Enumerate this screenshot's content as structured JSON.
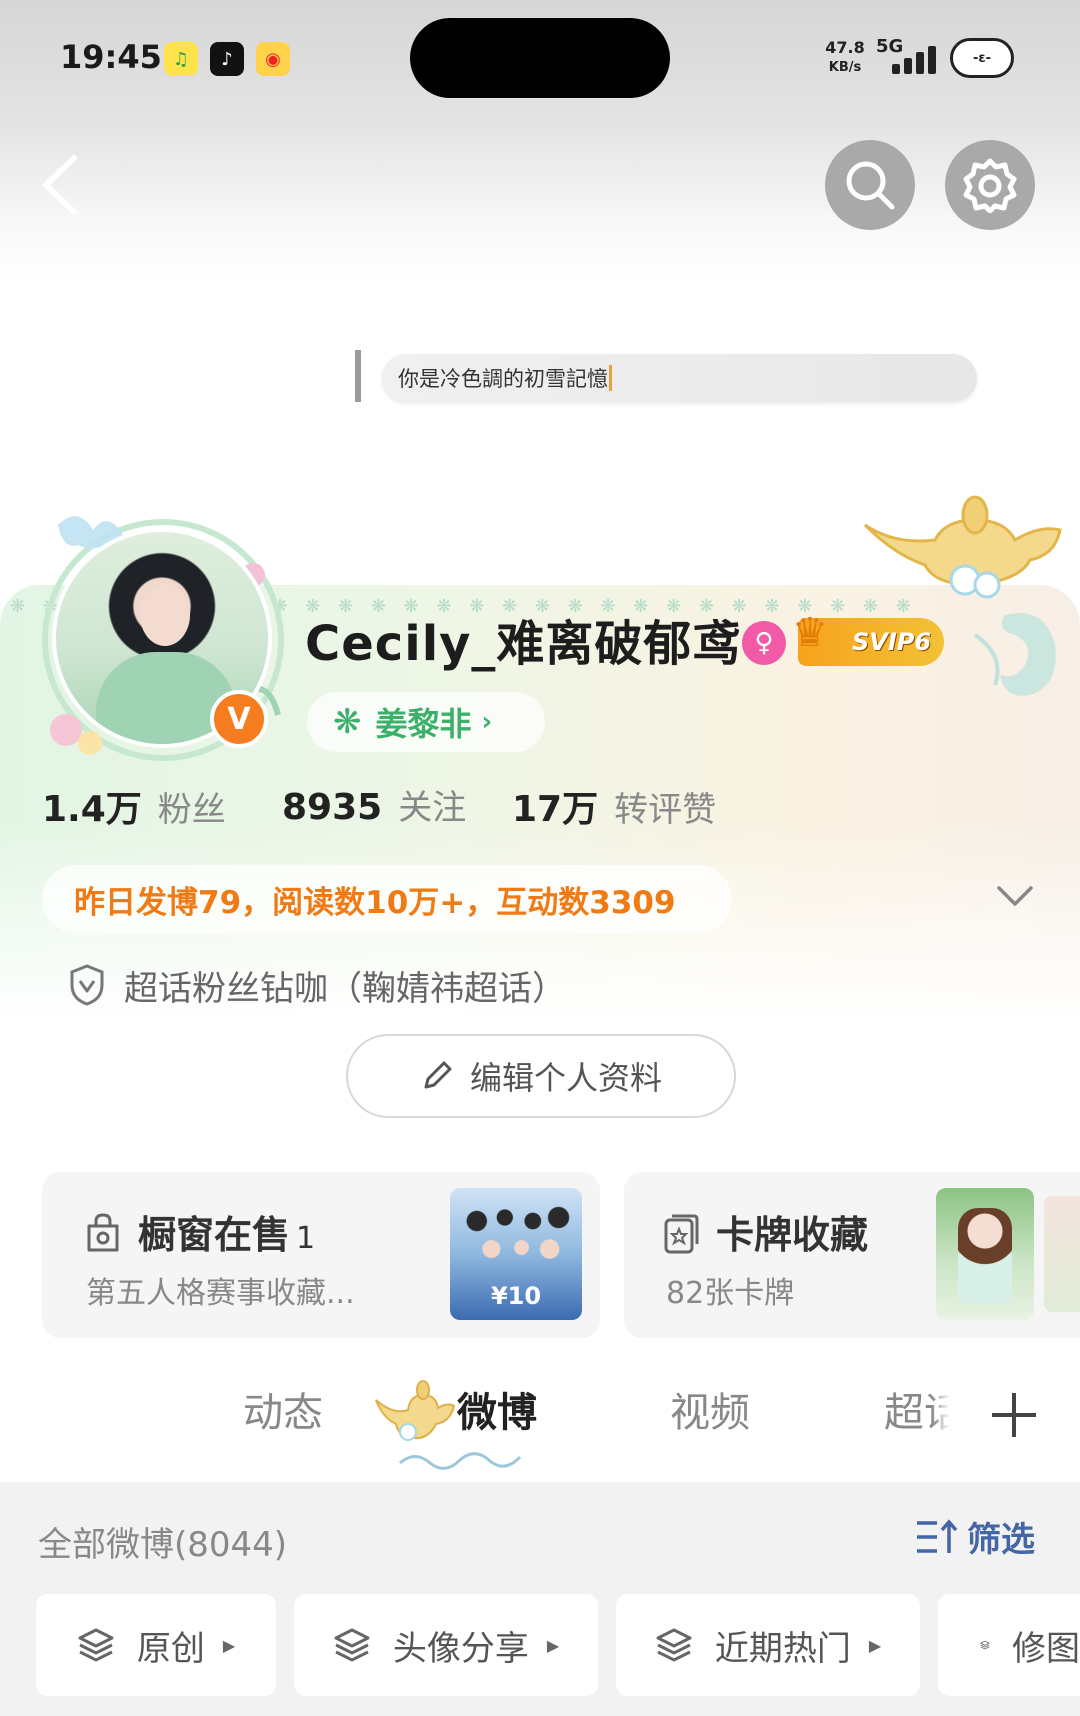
{
  "status_bar": {
    "time": "19:45",
    "app_icons": [
      "qq-music-icon",
      "tiktok-icon",
      "weibo-icon"
    ],
    "net_speed_value": "47.8",
    "net_speed_unit": "KB/s",
    "network": "5G",
    "battery_glyph": "-ε-"
  },
  "nav": {
    "back_icon": "chevron-left-icon",
    "search_icon": "search-icon",
    "settings_icon": "gear-icon"
  },
  "banner": {
    "text": "你是冷色調的初雪記憶"
  },
  "profile": {
    "username": "Cecily_难离破郁鸢",
    "gender_symbol": "♀",
    "svip_label": "SVIP6",
    "verified_glyph": "V",
    "star_chip": {
      "symbol": "❋",
      "label": "姜黎非",
      "chevron": "›"
    },
    "stats": [
      {
        "num": "1.4万",
        "label": "粉丝"
      },
      {
        "num": "8935",
        "label": "关注"
      },
      {
        "num": "17万",
        "label": "转评赞"
      }
    ],
    "daily_summary": "昨日发博79，阅读数10万+，互动数3309",
    "fan_title": "超话粉丝钻咖（鞠婧祎超话）",
    "edit_button": "编辑个人资料"
  },
  "showcase": {
    "shop": {
      "title": "橱窗在售",
      "count": "1",
      "subtitle": "第五人格赛事收藏...",
      "thumb_price": "¥10"
    },
    "cards": {
      "title": "卡牌收藏",
      "subtitle": "82张卡牌"
    }
  },
  "tabs": [
    {
      "label": "动态",
      "active": false
    },
    {
      "label": "微博",
      "active": true
    },
    {
      "label": "视频",
      "active": false
    },
    {
      "label": "超话",
      "active": false
    }
  ],
  "feed": {
    "all_label": "全部微博(8044)",
    "filter_label": "筛选",
    "chips": [
      "原创",
      "头像分享",
      "近期热门",
      "修图"
    ]
  },
  "colors": {
    "accent_orange": "#f07a14",
    "filter_blue": "#4566a6",
    "star_green": "#3bb06b",
    "gender_pink": "#f25aa8"
  }
}
